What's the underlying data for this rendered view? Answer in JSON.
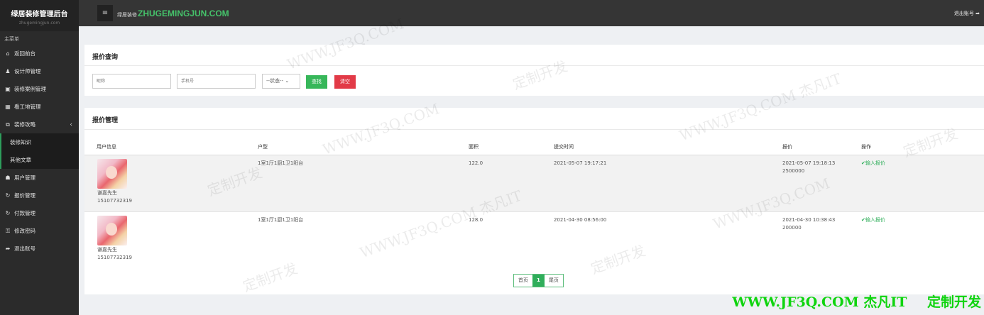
{
  "sidebar": {
    "brand_title": "绿居装修管理后台",
    "brand_sub": "zhugemingjun.com",
    "menu_header": "主菜单",
    "items": [
      {
        "label": "返回前台",
        "icon": "⌂"
      },
      {
        "label": "设计师管理",
        "icon": "♟"
      },
      {
        "label": "装修案例管理",
        "icon": "▣"
      },
      {
        "label": "看工地管理",
        "icon": "▦"
      },
      {
        "label": "装修攻略",
        "icon": "⧉",
        "arrow": "‹"
      },
      {
        "label": "装修知识"
      },
      {
        "label": "其他文章"
      },
      {
        "label": "用户管理",
        "icon": "☗"
      },
      {
        "label": "报价管理",
        "icon": "↻"
      },
      {
        "label": "付款管理",
        "icon": "↻"
      },
      {
        "label": "修改密码",
        "icon": "⚿"
      },
      {
        "label": "退出账号",
        "icon": "➦"
      }
    ]
  },
  "topbar": {
    "toggle": "≡",
    "title_cn": "绿居装修",
    "title_en": "ZHUGEMINGJUN.COM",
    "logout": "退出账号 ➦"
  },
  "query": {
    "title": "报价查询",
    "nickname_placeholder": "昵称",
    "phone_placeholder": "手机号",
    "status_select": "--状态-- ⌄",
    "search_label": "查找",
    "clear_label": "清空"
  },
  "table": {
    "title": "报价管理",
    "headers": [
      "用户信息",
      "户型",
      "面积",
      "提交时间",
      "报价",
      "操作"
    ],
    "rows": [
      {
        "name": "谦嘉先生",
        "phone": "15107732319",
        "layout": "1室1厅1厨1卫1阳台",
        "area": "122.0",
        "submit_time": "2021-05-07 19:17:21",
        "quote_time": "2021-05-07 19:18:13",
        "quote": "2500000",
        "op": "✔输入报价"
      },
      {
        "name": "谦嘉先生",
        "phone": "15107732319",
        "layout": "1室1厅1厨1卫1阳台",
        "area": "128.0",
        "submit_time": "2021-04-30 08:56:00",
        "quote_time": "2021-04-30 10:38:43",
        "quote": "200000",
        "op": "✔输入报价"
      }
    ]
  },
  "pager": {
    "first": "首页",
    "current": "1",
    "last": "尾页"
  },
  "watermark": {
    "site": "WWW.JF3Q.COM",
    "brand": "杰凡IT",
    "tagline": "定制开发",
    "site_brand": "WWW.JF3Q.COM 杰凡IT"
  },
  "colors": {
    "accent": "#2fae5a",
    "danger": "#e23a47",
    "title_green": "#45c26a",
    "footer_green": "#0fd40f"
  }
}
